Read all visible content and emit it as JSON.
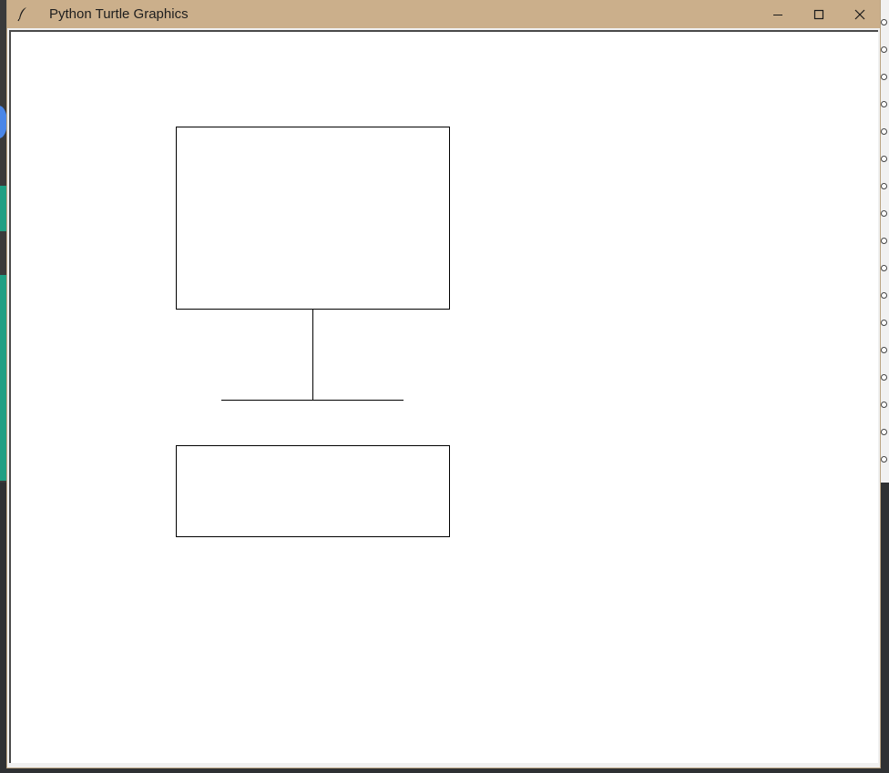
{
  "window": {
    "title": "Python Turtle Graphics",
    "app_icon": "feather-icon",
    "titlebar_color": "#cbaf8b",
    "controls": {
      "minimize": "minimize-icon",
      "maximize": "maximize-icon",
      "close": "close-icon"
    }
  },
  "canvas": {
    "background": "#ffffff",
    "stroke": "#000000",
    "drawing": [
      "upper-rectangle",
      "vertical-stem",
      "horizontal-base-line",
      "lower-rectangle"
    ]
  }
}
